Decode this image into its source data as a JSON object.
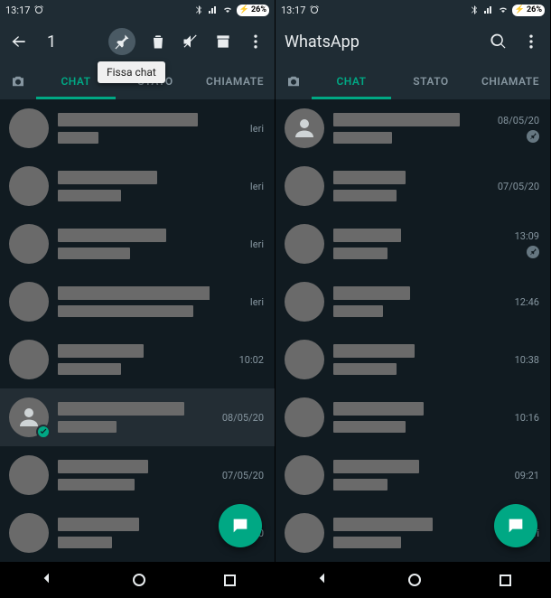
{
  "statusbar": {
    "time": "13:17",
    "battery": "26%"
  },
  "left": {
    "selection_count": "1",
    "tooltip": "Fissa chat",
    "tabs": {
      "chat": "CHAT",
      "stato": "STATO",
      "chiamate": "CHIAMATE"
    },
    "chats": [
      {
        "time": "Ieri",
        "nameW": 155,
        "msgW": 45,
        "pinned": false,
        "selected": false,
        "person": false
      },
      {
        "time": "Ieri",
        "nameW": 110,
        "msgW": 70,
        "pinned": false,
        "selected": false,
        "person": false
      },
      {
        "time": "Ieri",
        "nameW": 120,
        "msgW": 80,
        "pinned": false,
        "selected": false,
        "person": false
      },
      {
        "time": "Ieri",
        "nameW": 175,
        "msgW": 150,
        "pinned": false,
        "selected": false,
        "person": false
      },
      {
        "time": "10:02",
        "nameW": 95,
        "msgW": 70,
        "pinned": false,
        "selected": false,
        "person": false
      },
      {
        "time": "08/05/20",
        "nameW": 140,
        "msgW": 65,
        "pinned": false,
        "selected": true,
        "person": true
      },
      {
        "time": "07/05/20",
        "nameW": 100,
        "msgW": 85,
        "pinned": false,
        "selected": false,
        "person": false
      },
      {
        "time": "07/05/20",
        "nameW": 90,
        "msgW": 60,
        "pinned": false,
        "selected": false,
        "person": false
      }
    ]
  },
  "right": {
    "title": "WhatsApp",
    "tabs": {
      "chat": "CHAT",
      "stato": "STATO",
      "chiamate": "CHIAMATE"
    },
    "chats": [
      {
        "time": "08/05/20",
        "nameW": 140,
        "msgW": 65,
        "pinned": true,
        "selected": false,
        "person": true
      },
      {
        "time": "07/05/20",
        "nameW": 80,
        "msgW": 70,
        "pinned": false,
        "selected": false,
        "person": false
      },
      {
        "time": "13:09",
        "nameW": 75,
        "msgW": 60,
        "pinned": true,
        "selected": false,
        "person": false
      },
      {
        "time": "12:46",
        "nameW": 85,
        "msgW": 55,
        "pinned": false,
        "selected": false,
        "person": false
      },
      {
        "time": "10:38",
        "nameW": 90,
        "msgW": 70,
        "pinned": false,
        "selected": false,
        "person": false
      },
      {
        "time": "10:16",
        "nameW": 100,
        "msgW": 80,
        "pinned": false,
        "selected": false,
        "person": false
      },
      {
        "time": "09:21",
        "nameW": 95,
        "msgW": 60,
        "pinned": false,
        "selected": false,
        "person": false
      },
      {
        "time": "Ieri",
        "nameW": 110,
        "msgW": 75,
        "pinned": false,
        "selected": false,
        "person": false
      }
    ]
  }
}
